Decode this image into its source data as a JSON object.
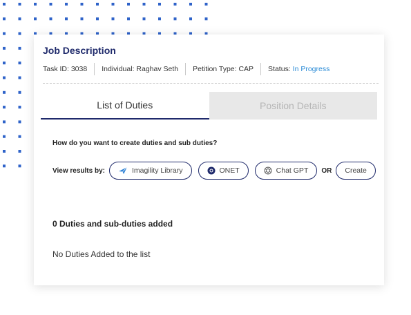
{
  "colors": {
    "accent": "#1f2a6b",
    "dots": "#2f63c9",
    "status": "#2a8bd6"
  },
  "header": {
    "title": "Job Description",
    "task_id": "Task ID: 3038",
    "individual": "Individual: Raghav Seth",
    "petition_type": "Petition Type: CAP",
    "status_label": "Status: ",
    "status_value": "In Progress"
  },
  "tabs": [
    {
      "label": "List of Duties",
      "active": true
    },
    {
      "label": "Position Details",
      "active": false
    }
  ],
  "question": "How do you want to create duties and sub duties?",
  "view_results": {
    "label": "View results by:",
    "options": [
      {
        "label": "Imagility Library",
        "icon": "paper-plane-icon"
      },
      {
        "label": "ONET",
        "icon": "onet-logo-icon"
      },
      {
        "label": "Chat GPT",
        "icon": "chatgpt-logo-icon"
      }
    ],
    "or_label": "OR",
    "create_label": "Create"
  },
  "duties": {
    "count_text": "0 Duties and sub-duties added",
    "empty_text": "No Duties Added to the list"
  }
}
